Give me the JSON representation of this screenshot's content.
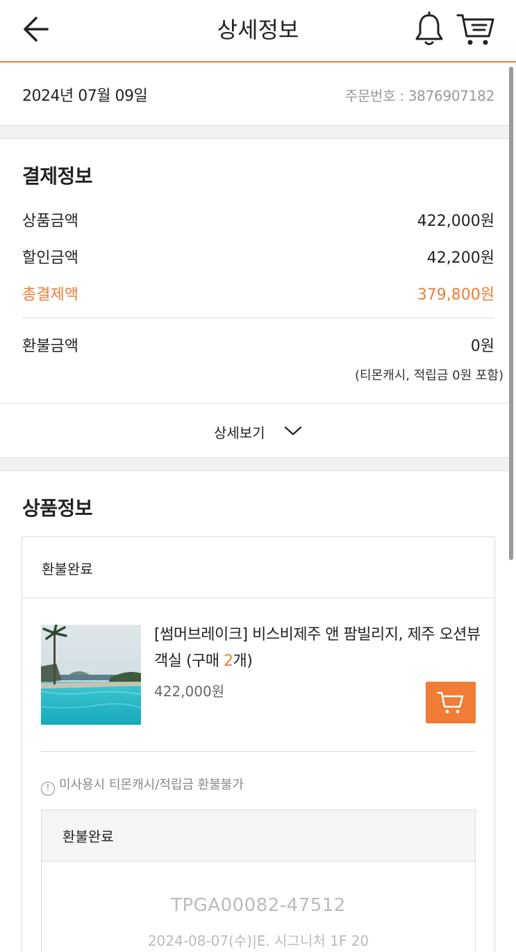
{
  "header": {
    "title": "상세정보",
    "icons": [
      "back-arrow-icon",
      "bell-icon",
      "cart-icon"
    ]
  },
  "order": {
    "date": "2024년 07월 09일",
    "order_number_label": "주문번호 : ",
    "order_number": "3876907182"
  },
  "payment": {
    "title": "결제정보",
    "product_amount_label": "상품금액",
    "product_amount": "422,000원",
    "discount_label": "할인금액",
    "discount": "42,200원",
    "total_label": "총결제액",
    "total": "379,800원",
    "refund_label": "환불금액",
    "refund": "0원",
    "refund_note": "(티몬캐시, 적립금 0원 포함)",
    "detail_button": "상세보기"
  },
  "product": {
    "title": "상품정보",
    "status": "환불완료",
    "name_prefix": "[썸머브레이크] 비스비제주 앤 팜빌리지, 제주 오션뷰 객실 (구매 ",
    "quantity": "2",
    "name_suffix": "개)",
    "price": "422,000원",
    "notice": "미사용시 티몬캐시/적립금 환불불가",
    "ticket": {
      "status": "환불완료",
      "code": "TPGA00082-47512",
      "date_info": "2024-08-07(수)|E. 시그니처 1F 20"
    }
  },
  "colors": {
    "accent": "#f07c36",
    "text": "#222222",
    "muted": "#999999"
  }
}
